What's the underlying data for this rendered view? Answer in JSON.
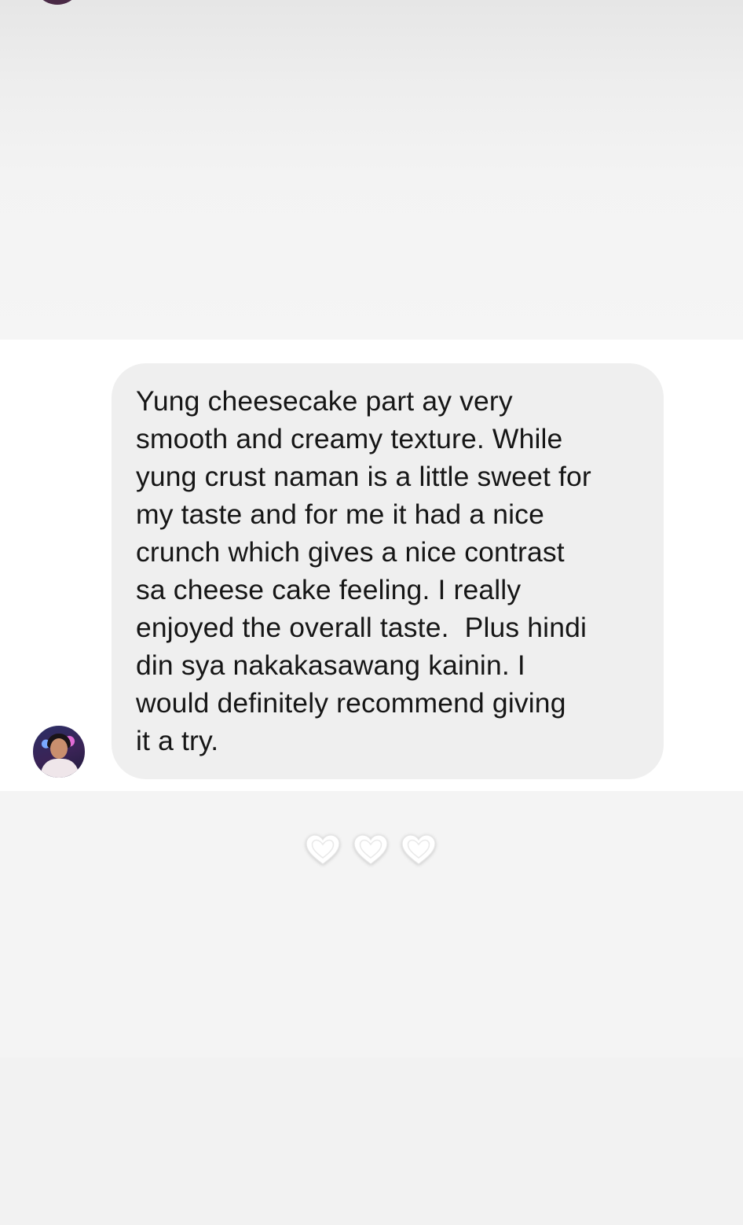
{
  "message": {
    "lines": [
      "Yung cheesecake part ay very",
      "smooth and creamy texture. While",
      "yung crust naman is a little sweet for",
      "my taste and for me it had a nice",
      "crunch which gives a nice contrast",
      "sa cheese cake feeling. I really",
      "enjoyed the overall taste.  Plus hindi",
      "din sya nakakasawang kainin. I",
      "would definitely recommend giving",
      "it a try."
    ],
    "avatar_icon": "user-avatar",
    "bubble_color": "#efefef",
    "text_color": "#161616"
  },
  "reactions": [
    {
      "icon": "heart-outline-icon"
    },
    {
      "icon": "heart-outline-icon"
    },
    {
      "icon": "heart-outline-icon"
    }
  ],
  "colors": {
    "page_background": "#f4f4f4",
    "message_area_background": "#ffffff"
  }
}
